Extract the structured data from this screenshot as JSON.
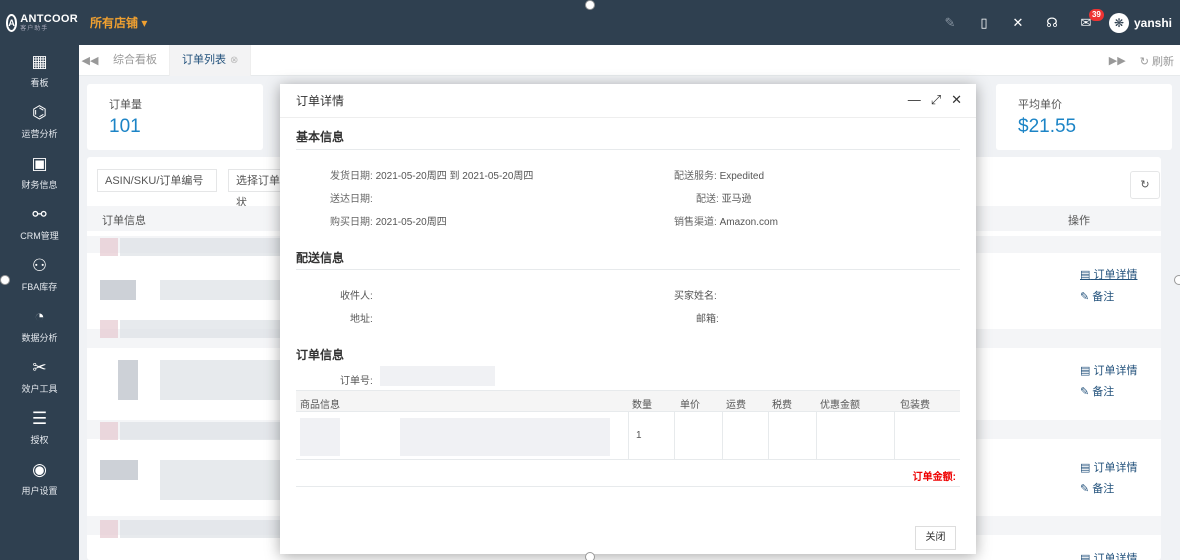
{
  "brand": {
    "logo_text": "ANTCOOR",
    "logo_sub": "客户助手"
  },
  "topbar": {
    "store_select": "所有店铺 ▾",
    "mail_badge": "39",
    "username": "yanshi"
  },
  "sidebar": {
    "items": [
      {
        "label": "看板",
        "icon": "dashboard-icon"
      },
      {
        "label": "运营分析",
        "icon": "operations-icon"
      },
      {
        "label": "财务信息",
        "icon": "finance-icon"
      },
      {
        "label": "CRM管理",
        "icon": "crm-icon"
      },
      {
        "label": "FBA库存",
        "icon": "inventory-icon"
      },
      {
        "label": "数据分析",
        "icon": "chart-icon"
      },
      {
        "label": "效户工具",
        "icon": "tools-icon"
      },
      {
        "label": "授权",
        "icon": "authorize-icon"
      },
      {
        "label": "用户设置",
        "icon": "user-settings-icon"
      }
    ]
  },
  "tabs": {
    "items": [
      "综合看板",
      "订单列表"
    ],
    "active": 1,
    "refresh": "刷新"
  },
  "background": {
    "stats": [
      {
        "label": "订单量",
        "value": "101"
      },
      {
        "label": "平均单价",
        "value": "$21.55"
      }
    ],
    "search_placeholder": "ASIN/SKU/订单编号",
    "status_select": "选择订单状",
    "col_order_info": "订单信息",
    "col_actions": "操作",
    "link_detail": "订单详情",
    "link_note": "备注"
  },
  "modal": {
    "title": "订单详情",
    "basic": {
      "title": "基本信息",
      "ship_date_label": "发货日期:",
      "ship_date": "2021-05-20周四 到 2021-05-20周四",
      "delivery_date_label": "送达日期:",
      "delivery_date": "",
      "purchase_date_label": "购买日期:",
      "purchase_date": "2021-05-20周四",
      "ship_service_label": "配送服务:",
      "ship_service": "Expedited",
      "fulfillment_label": "配送:",
      "fulfillment": "亚马逊",
      "channel_label": "销售渠道:",
      "channel": "Amazon.com"
    },
    "shipping": {
      "title": "配送信息",
      "recipient_label": "收件人:",
      "address_label": "地址:",
      "buyer_name_label": "买家姓名:",
      "email_label": "邮箱:"
    },
    "order": {
      "title": "订单信息",
      "order_no_label": "订单号:",
      "columns": [
        "商品信息",
        "数量",
        "单价",
        "运费",
        "税费",
        "优惠金额",
        "包装费"
      ],
      "rows": [
        {
          "qty": "1"
        }
      ],
      "total_label": "订单金额:"
    },
    "close_label": "关闭"
  }
}
